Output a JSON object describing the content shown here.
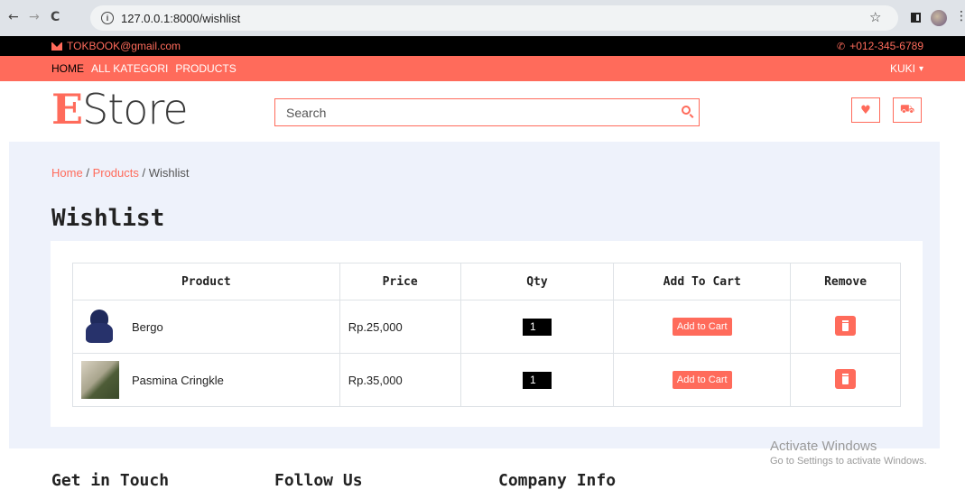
{
  "browser": {
    "back": "←",
    "forward": "→",
    "reload": "C",
    "url": "127.0.0.1:8000/wishlist",
    "star": "☆",
    "menu": "⋮"
  },
  "topbar": {
    "email": "TOKBOOK@gmail.com",
    "phone": "+012-345-6789"
  },
  "nav": {
    "links": [
      "HOME",
      "ALL KATEGORI",
      "PRODUCTS"
    ],
    "user": "KUKI",
    "caret": "▾"
  },
  "header": {
    "logo_first": "E",
    "logo_rest": "Store",
    "search_placeholder": "Search",
    "wishlist_icon": "♥",
    "cart_icon": "⛟"
  },
  "breadcrumb": {
    "home": "Home",
    "products": "Products",
    "current": "Wishlist",
    "sep": "/"
  },
  "page": {
    "title": "Wishlist"
  },
  "table": {
    "headers": [
      "Product",
      "Price",
      "Qty",
      "Add To Cart",
      "Remove"
    ],
    "rows": [
      {
        "product": "Bergo",
        "price": "Rp.25,000",
        "qty": "1",
        "action": "Add to Cart"
      },
      {
        "product": "Pasmina Cringkle",
        "price": "Rp.35,000",
        "qty": "1",
        "action": "Add to Cart"
      }
    ]
  },
  "footer": {
    "headings": [
      "Get in Touch",
      "Follow Us",
      "Company Info"
    ]
  },
  "watermark": {
    "line1": "Activate Windows",
    "line2": "Go to Settings to activate Windows."
  },
  "colors": {
    "accent": "#ff6b5b",
    "bg_main": "#eef2fb"
  }
}
